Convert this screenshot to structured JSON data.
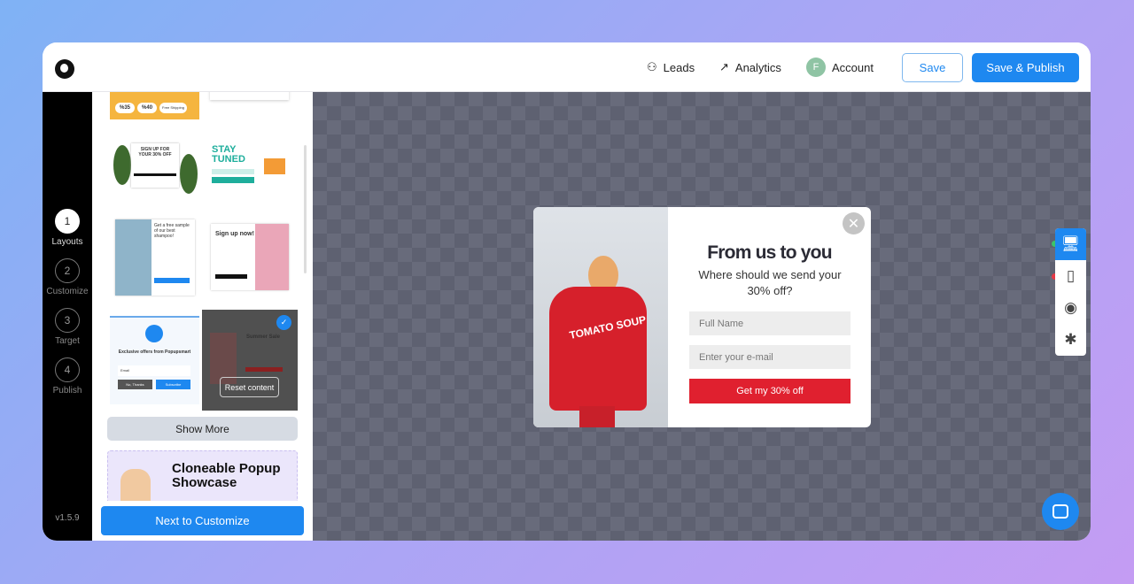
{
  "header": {
    "leads": "Leads",
    "analytics": "Analytics",
    "account_initial": "F",
    "account": "Account",
    "save": "Save",
    "save_publish": "Save & Publish"
  },
  "steps": [
    {
      "n": "1",
      "label": "Layouts"
    },
    {
      "n": "2",
      "label": "Customize"
    },
    {
      "n": "3",
      "label": "Target"
    },
    {
      "n": "4",
      "label": "Publish"
    }
  ],
  "version": "v1.5.9",
  "templates": {
    "discount": [
      "%35",
      "%40",
      "Free Shipping"
    ],
    "signup30": "SIGN UP FOR YOUR 30% OFF",
    "stay_tuned": "STAY TUNED",
    "shampoo": "Get a free sample of our best shampoo!",
    "signup_now": "Sign up now!",
    "popupsmart": {
      "title": "Exclusive offers from Popupsmart",
      "email": "Email",
      "no": "No, Thanks",
      "subscribe": "Subscribe"
    },
    "summer": "Summer Sale",
    "reset": "Reset content"
  },
  "show_more": "Show More",
  "showcase": "Cloneable Popup Showcase",
  "next": "Next to Customize",
  "popup": {
    "image_text": "TOMATO SOUP",
    "title": "From us to you",
    "subtitle": "Where should we send your 30% off?",
    "name_placeholder": "Full Name",
    "email_placeholder": "Enter your e-mail",
    "button": "Get my 30% off"
  },
  "colors": {
    "accent": "#1e88f0",
    "popup_button": "#e0202f"
  }
}
